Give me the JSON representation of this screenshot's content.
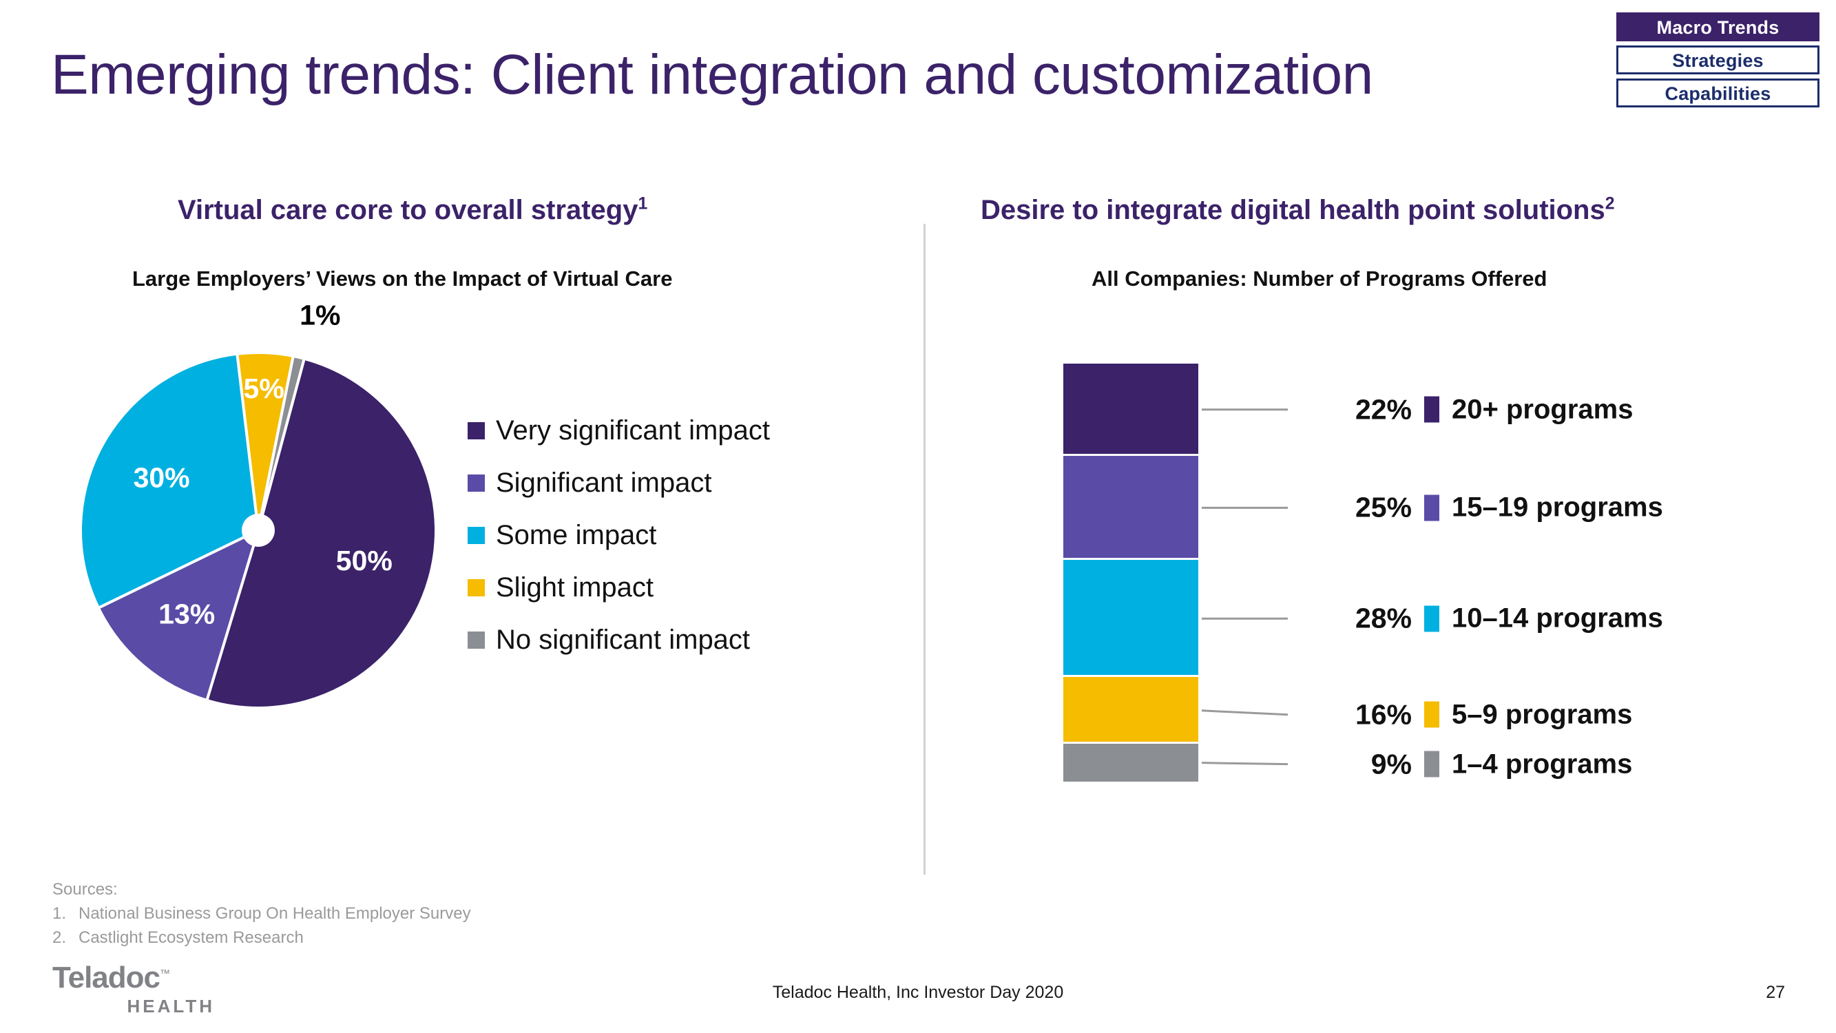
{
  "nav": {
    "items": [
      {
        "label": "Macro Trends",
        "active": true
      },
      {
        "label": "Strategies",
        "active": false
      },
      {
        "label": "Capabilities",
        "active": false
      }
    ]
  },
  "title": "Emerging trends: Client integration and customization",
  "left_panel": {
    "heading": "Virtual care core to overall strategy",
    "heading_sup": "1",
    "subheading": "Large Employers’ Views on the Impact of Virtual Care"
  },
  "right_panel": {
    "heading": "Desire to integrate digital health point solutions",
    "heading_sup": "2",
    "subheading": "All Companies: Number of Programs Offered"
  },
  "colors": {
    "dark_purple": "#3b2269",
    "mid_purple": "#5a4ba6",
    "cyan": "#00b0e0",
    "yellow": "#f5bc00",
    "gray": "#8b8e93",
    "navy": "#1c2d6b",
    "divider": "#d2d2d2",
    "source_text": "#9a9a9a",
    "logo_gray": "#808285"
  },
  "sources": {
    "title": "Sources:",
    "items": [
      {
        "num": "1.",
        "text": "National Business Group On Health Employer Survey"
      },
      {
        "num": "2.",
        "text": "Castlight Ecosystem Research"
      }
    ]
  },
  "logo": {
    "word": "Teladoc",
    "tm": "™",
    "sub": "HEALTH"
  },
  "footer": {
    "text": "Teladoc Health, Inc Investor Day 2020",
    "page_number": "27"
  },
  "chart_data": [
    {
      "type": "pie",
      "title": "Virtual care core to overall strategy",
      "subtitle": "Large Employers’ Views on the Impact of Virtual Care",
      "legend_position": "right",
      "start_angle_deg": 15,
      "donut_hole": true,
      "categories": [
        "Very significant impact",
        "Significant impact",
        "Some impact",
        "Slight impact",
        "No significant impact"
      ],
      "values": [
        50,
        13,
        30,
        5,
        1
      ],
      "value_labels": [
        "50%",
        "13%",
        "30%",
        "5%",
        "1%"
      ],
      "label_colors": [
        "#ffffff",
        "#ffffff",
        "#ffffff",
        "#000000",
        "#000000"
      ],
      "label_placement": [
        "inside",
        "inside",
        "inside",
        "inside",
        "outside"
      ],
      "colors": [
        "#3b2269",
        "#5a4ba6",
        "#00b0e0",
        "#f5bc00",
        "#8b8e93"
      ]
    },
    {
      "type": "bar",
      "orientation": "stacked-vertical",
      "title": "Desire to integrate digital health point solutions",
      "subtitle": "All Companies: Number of Programs Offered",
      "legend_position": "right",
      "categories": [
        "20+ programs",
        "15–19 programs",
        "10–14 programs",
        "5–9 programs",
        "1–4 programs"
      ],
      "values": [
        22,
        25,
        28,
        16,
        9
      ],
      "value_labels": [
        "22%",
        "25%",
        "28%",
        "16%",
        "9%"
      ],
      "colors": [
        "#3b2269",
        "#5a4ba6",
        "#00b0e0",
        "#f5bc00",
        "#8b8e93"
      ],
      "ylim": [
        0,
        100
      ]
    }
  ]
}
